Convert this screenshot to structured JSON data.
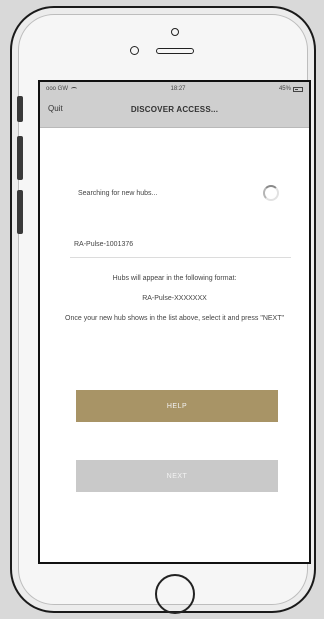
{
  "status_bar": {
    "carrier": "ooo GW",
    "time": "18:27",
    "battery": "45%"
  },
  "nav": {
    "left_label": "Quit",
    "title": "DISCOVER ACCESS..."
  },
  "search": {
    "text": "Searching for new hubs..."
  },
  "hubs": [
    {
      "label": "RA-Pulse-1001376"
    }
  ],
  "info": {
    "line1": "Hubs will appear in the following format:",
    "format": "RA-Pulse-XXXXXXX",
    "instructions": "Once your new hub shows in the list above, select it and press \"NEXT\""
  },
  "buttons": {
    "help_label": "HELP",
    "next_label": "NEXT"
  },
  "colors": {
    "help_button": "#a89466",
    "next_button_disabled": "#c9c9c9",
    "nav_bar": "#cfcfcf"
  }
}
